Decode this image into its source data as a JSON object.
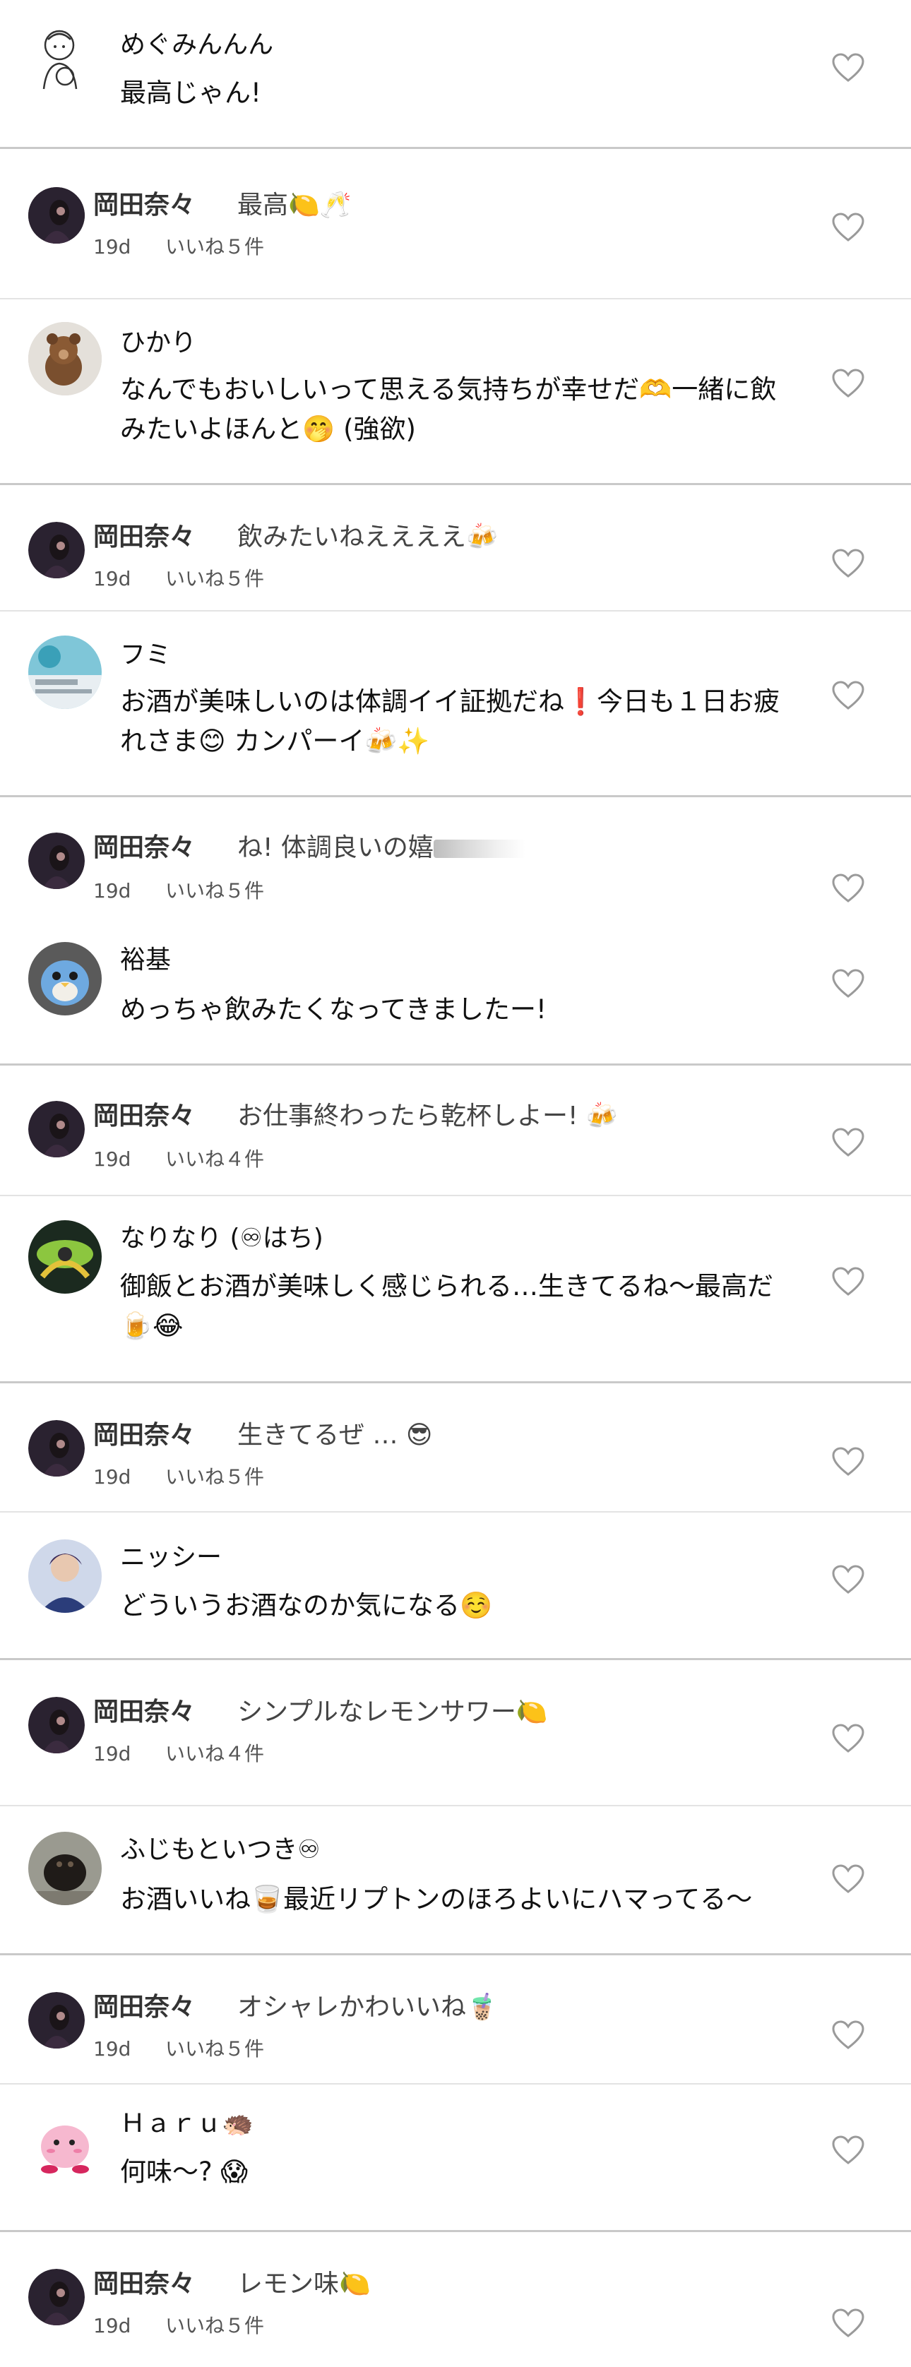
{
  "comments": [
    {
      "name": "めぐみんんん",
      "text": "最高じゃん!"
    },
    {
      "name": "ひかり",
      "text": "なんでもおいしいって思える気持ちが幸せだ🫶一緒に飲みたいよほんと🤭 (強欲)"
    },
    {
      "name": "フミ",
      "text": "お酒が美味しいのは体調イイ証拠だね❗今日も１日お疲れさま😊 カンパーイ🍻✨"
    },
    {
      "name": "裕基",
      "text": "めっちゃ飲みたくなってきましたー!"
    },
    {
      "name": "なりなり (♾はち)",
      "text": "御飯とお酒が美味しく感じられる…生きてるね〜最高だ🍺😂"
    },
    {
      "name": "ニッシー",
      "text": "どういうお酒なのか気になる☺️"
    },
    {
      "name": "ふじもといつき♾",
      "text": "お酒いいね🥃最近リプトンのほろよいにハマってる〜"
    },
    {
      "name": "Ｈａｒｕ🦔",
      "text": "何味〜? 😱"
    }
  ],
  "replies": [
    {
      "name": "岡田奈々",
      "text": "最高🍋🥂",
      "age": "19d",
      "likes": "いいね５件"
    },
    {
      "name": "岡田奈々",
      "text": "飲みたいねええええ🍻",
      "age": "19d",
      "likes": "いいね５件"
    },
    {
      "name": "岡田奈々",
      "text": "ね! 体調良いの嬉",
      "age": "19d",
      "likes": "いいね５件"
    },
    {
      "name": "岡田奈々",
      "text": "お仕事終わったら乾杯しよー! 🍻",
      "age": "19d",
      "likes": "いいね４件"
    },
    {
      "name": "岡田奈々",
      "text": "生きてるぜ … 😎",
      "age": "19d",
      "likes": "いいね５件"
    },
    {
      "name": "岡田奈々",
      "text": "シンプルなレモンサワー🍋",
      "age": "19d",
      "likes": "いいね４件"
    },
    {
      "name": "岡田奈々",
      "text": "オシャレかわいいね🧋",
      "age": "19d",
      "likes": "いいね５件"
    },
    {
      "name": "岡田奈々",
      "text": "レモン味🍋",
      "age": "19d",
      "likes": "いいね５件"
    }
  ],
  "icons": {
    "like": "heart-outline-icon"
  },
  "colors": {
    "divider_thread": "#c9c9c9",
    "divider_reply": "#e3e3e3",
    "heart": "#9a9a9a"
  }
}
